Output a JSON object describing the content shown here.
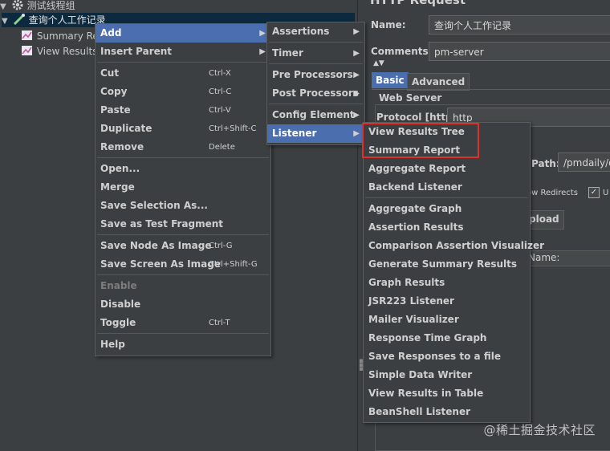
{
  "tree": {
    "thread_group": "测试线程组",
    "sampler": "查询个人工作记录",
    "child1": "Summary Re",
    "child2": "View Results"
  },
  "right": {
    "title": "HTTP Request",
    "name_label": "Name:",
    "name_value": "查询个人工作记录",
    "comments_label": "Comments:",
    "comments_value": "pm-server",
    "tab_basic": "Basic",
    "tab_advanced": "Advanced",
    "web_server": "Web Server",
    "protocol_label": "Protocol [http]:",
    "protocol_value": "http",
    "path_label": "Path:",
    "path_value": "/pmdaily/q",
    "follow_redirects": "ow Redirects",
    "upload_tab": "pload",
    "name_col": "Name:"
  },
  "context_menu": {
    "items": [
      {
        "label": "Add",
        "shortcut": "",
        "submenu": true
      },
      {
        "label": "Insert Parent",
        "shortcut": "",
        "submenu": true
      },
      {
        "label": "Cut",
        "shortcut": "Ctrl-X"
      },
      {
        "label": "Copy",
        "shortcut": "Ctrl-C"
      },
      {
        "label": "Paste",
        "shortcut": "Ctrl-V"
      },
      {
        "label": "Duplicate",
        "shortcut": "Ctrl+Shift-C"
      },
      {
        "label": "Remove",
        "shortcut": "Delete"
      },
      {
        "label": "Open...",
        "shortcut": ""
      },
      {
        "label": "Merge",
        "shortcut": ""
      },
      {
        "label": "Save Selection As...",
        "shortcut": ""
      },
      {
        "label": "Save as Test Fragment",
        "shortcut": ""
      },
      {
        "label": "Save Node As Image",
        "shortcut": "Ctrl-G"
      },
      {
        "label": "Save Screen As Image",
        "shortcut": "Ctrl+Shift-G"
      },
      {
        "label": "Enable",
        "shortcut": ""
      },
      {
        "label": "Disable",
        "shortcut": ""
      },
      {
        "label": "Toggle",
        "shortcut": "Ctrl-T"
      },
      {
        "label": "Help",
        "shortcut": ""
      }
    ]
  },
  "add_menu": {
    "items": [
      "Assertions",
      "Timer",
      "Pre Processors",
      "Post Processors",
      "Config Element",
      "Listener"
    ]
  },
  "listener_menu": {
    "items": [
      "View Results Tree",
      "Summary Report",
      "Aggregate Report",
      "Backend Listener",
      "Aggregate Graph",
      "Assertion Results",
      "Comparison Assertion Visualizer",
      "Generate Summary Results",
      "Graph Results",
      "JSR223 Listener",
      "Mailer Visualizer",
      "Response Time Graph",
      "Save Responses to a file",
      "Simple Data Writer",
      "View Results in Table",
      "BeanShell Listener"
    ]
  },
  "watermark": "@稀土掘金技术社区",
  "colors": {
    "background": "#3c3f41",
    "menu_highlight": "#4b6eaf",
    "selection": "#0d293e",
    "annotation_red": "#e0302a"
  }
}
